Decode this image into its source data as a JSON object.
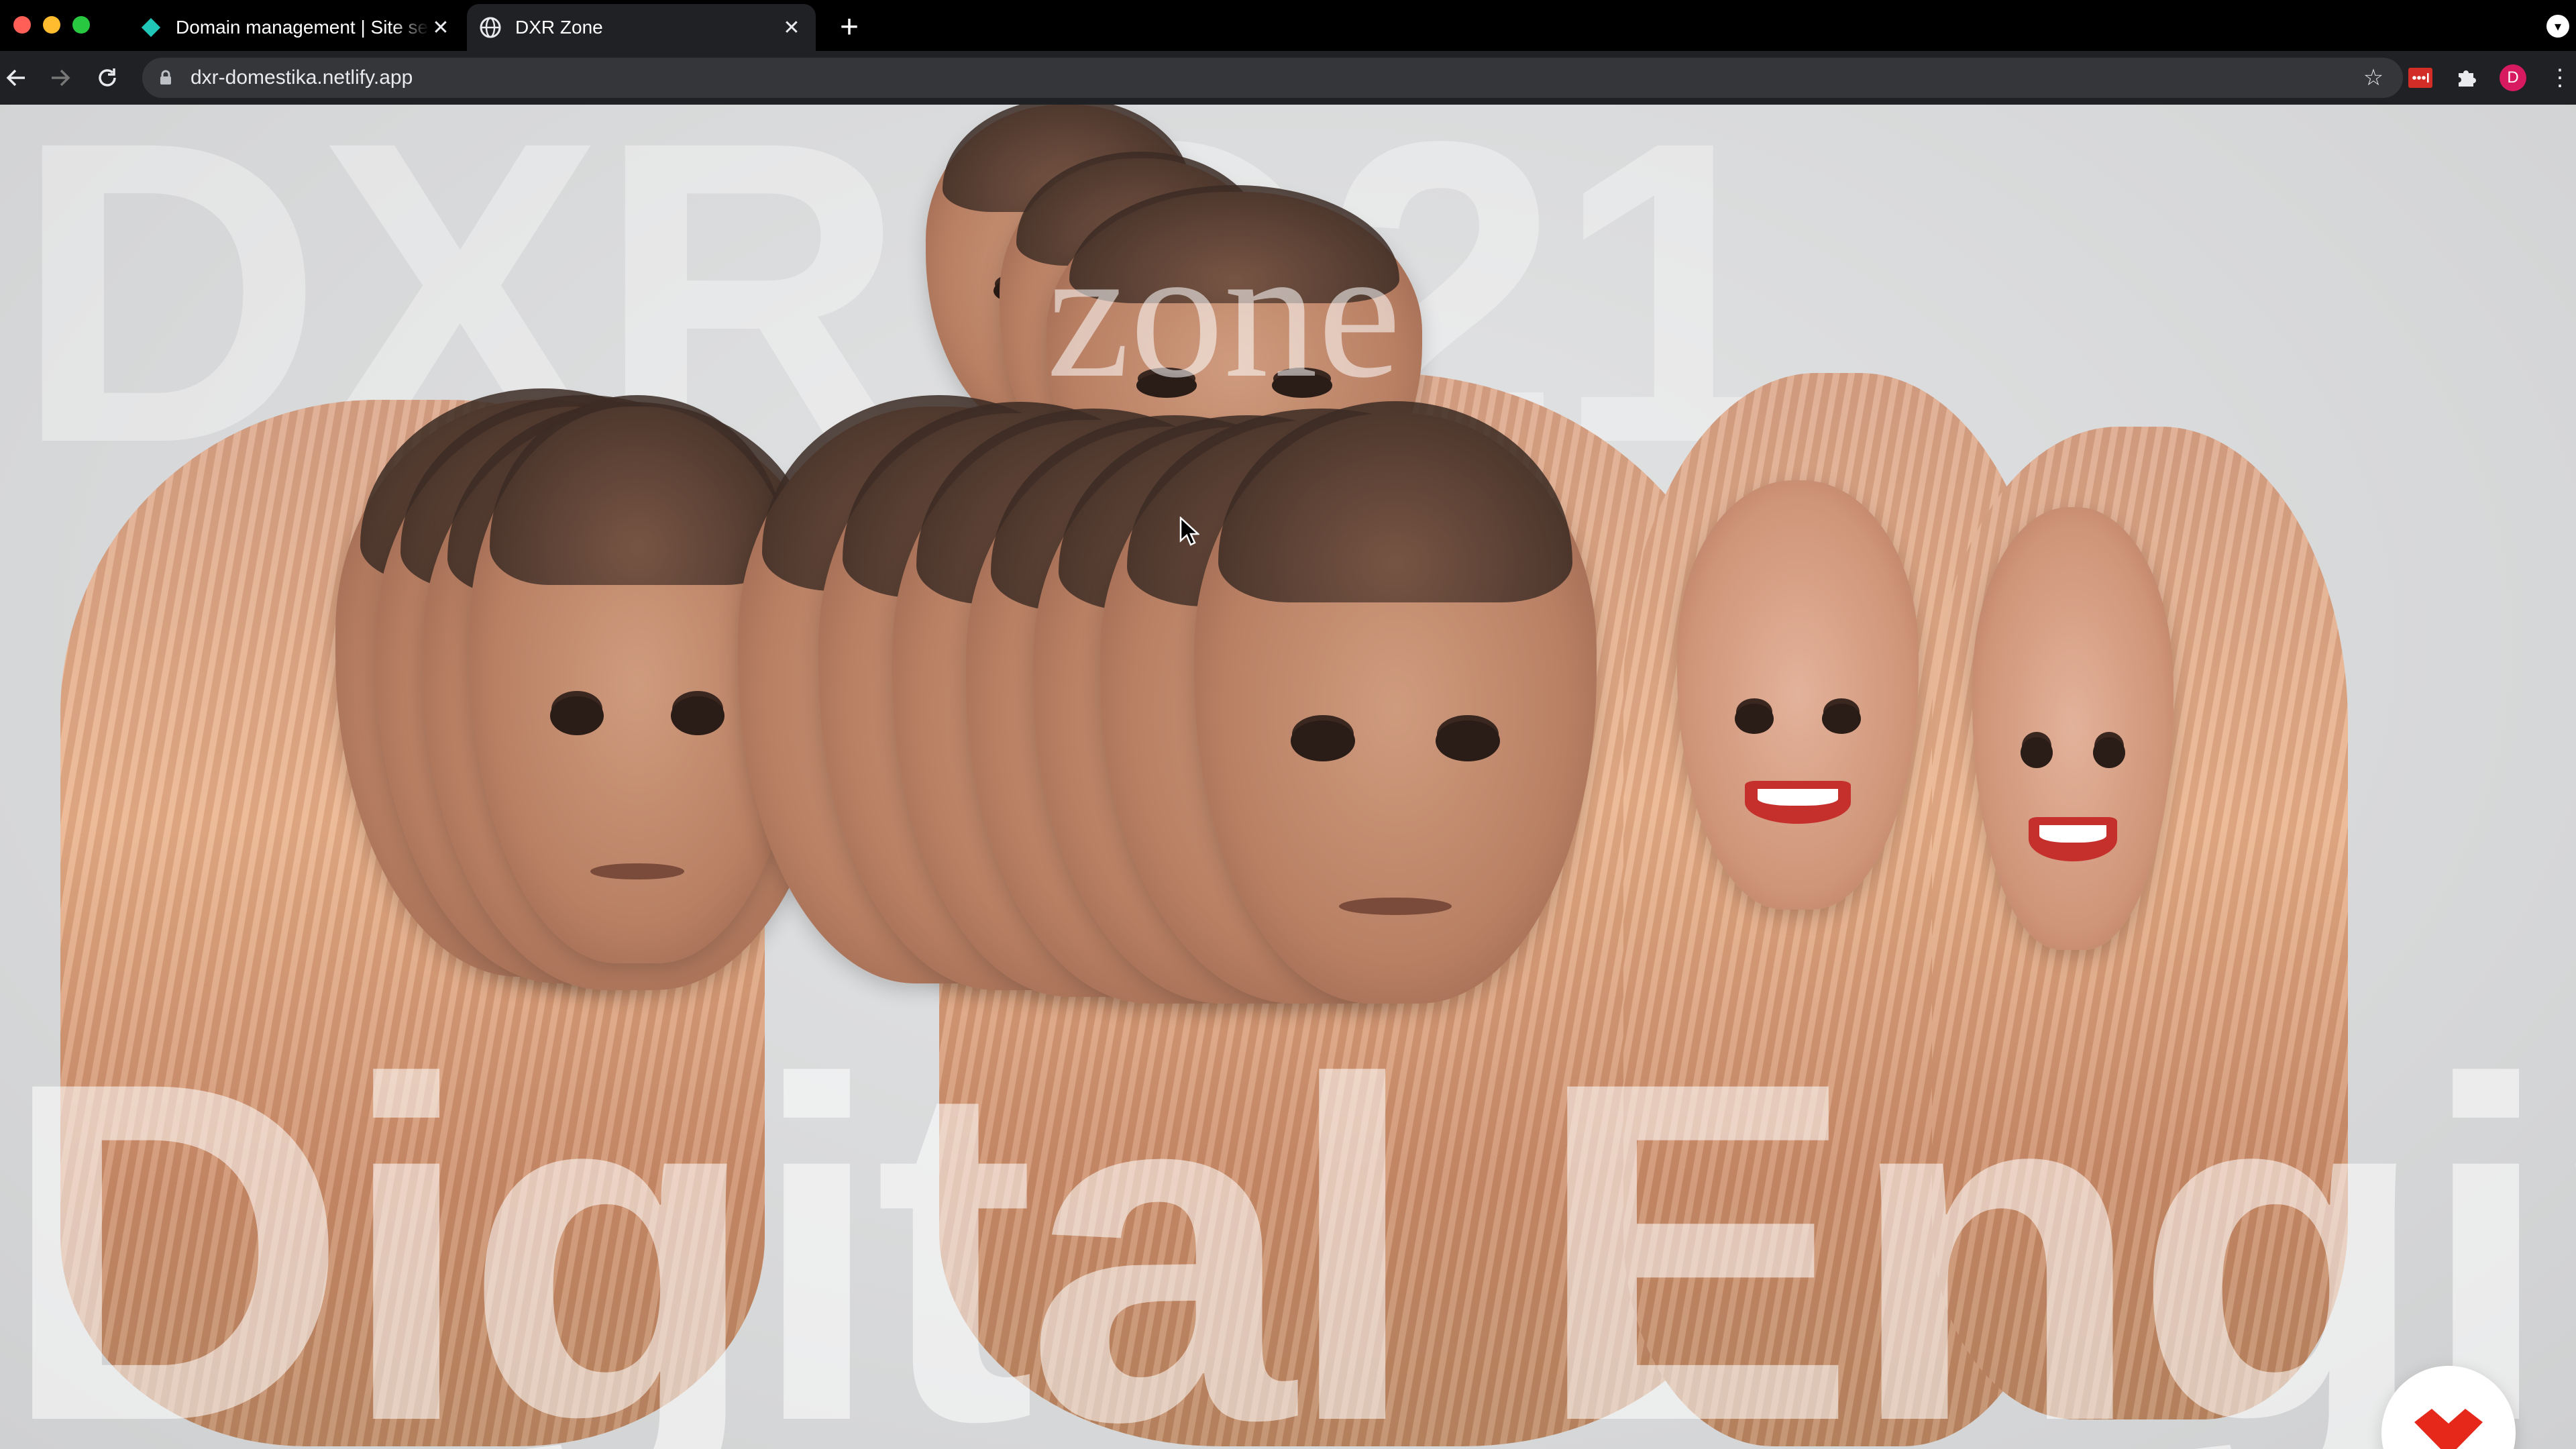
{
  "browser": {
    "tabs": [
      {
        "title": "Domain management | Site settings",
        "favicon": "netlify-diamond-icon",
        "active": false
      },
      {
        "title": "DXR Zone",
        "favicon": "globe-icon",
        "active": true
      }
    ],
    "url": "dxr-domestika.netlify.app",
    "profile_initial": "D"
  },
  "page": {
    "ghost_top_text": "DXR  ©21",
    "zone_text": "zone",
    "ghost_bottom_text": "Digital Engine"
  },
  "colors": {
    "accent_red": "#e5281a",
    "page_bg": "#dadbdc",
    "profile_pink": "#d81b60"
  }
}
